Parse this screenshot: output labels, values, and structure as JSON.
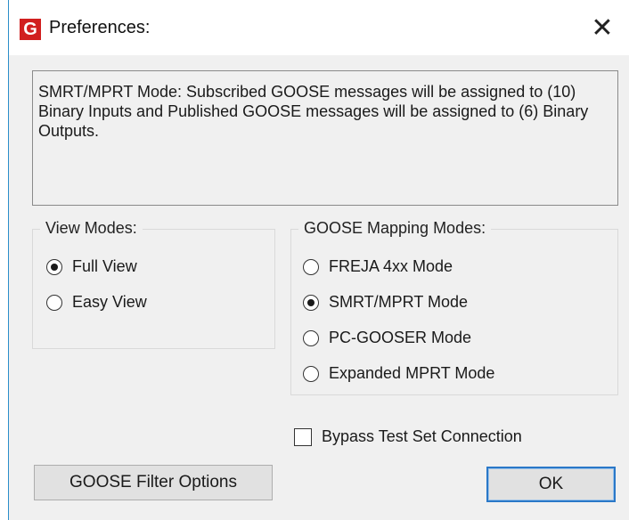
{
  "window": {
    "title": "Preferences:",
    "app_icon_letter": "G",
    "close_symbol": "✕"
  },
  "description": "SMRT/MPRT Mode:  Subscribed GOOSE messages will be assigned to (10) Binary Inputs and Published GOOSE messages will be assigned to (6) Binary Outputs.",
  "view_modes": {
    "label": "View Modes:",
    "options": [
      {
        "label": "Full View",
        "selected": true
      },
      {
        "label": "Easy View",
        "selected": false
      }
    ]
  },
  "goose_modes": {
    "label": "GOOSE Mapping Modes:",
    "options": [
      {
        "label": "FREJA 4xx Mode",
        "selected": false
      },
      {
        "label": "SMRT/MPRT Mode",
        "selected": true
      },
      {
        "label": "PC-GOOSER Mode",
        "selected": false
      },
      {
        "label": "Expanded MPRT Mode",
        "selected": false
      }
    ]
  },
  "bypass": {
    "label": "Bypass Test Set Connection",
    "checked": false
  },
  "buttons": {
    "filter_label": "GOOSE Filter Options",
    "ok_label": "OK"
  },
  "colors": {
    "app_icon": "#d11f1f",
    "window_border": "#2b8ec9",
    "default_button_border": "#2a78c8"
  }
}
